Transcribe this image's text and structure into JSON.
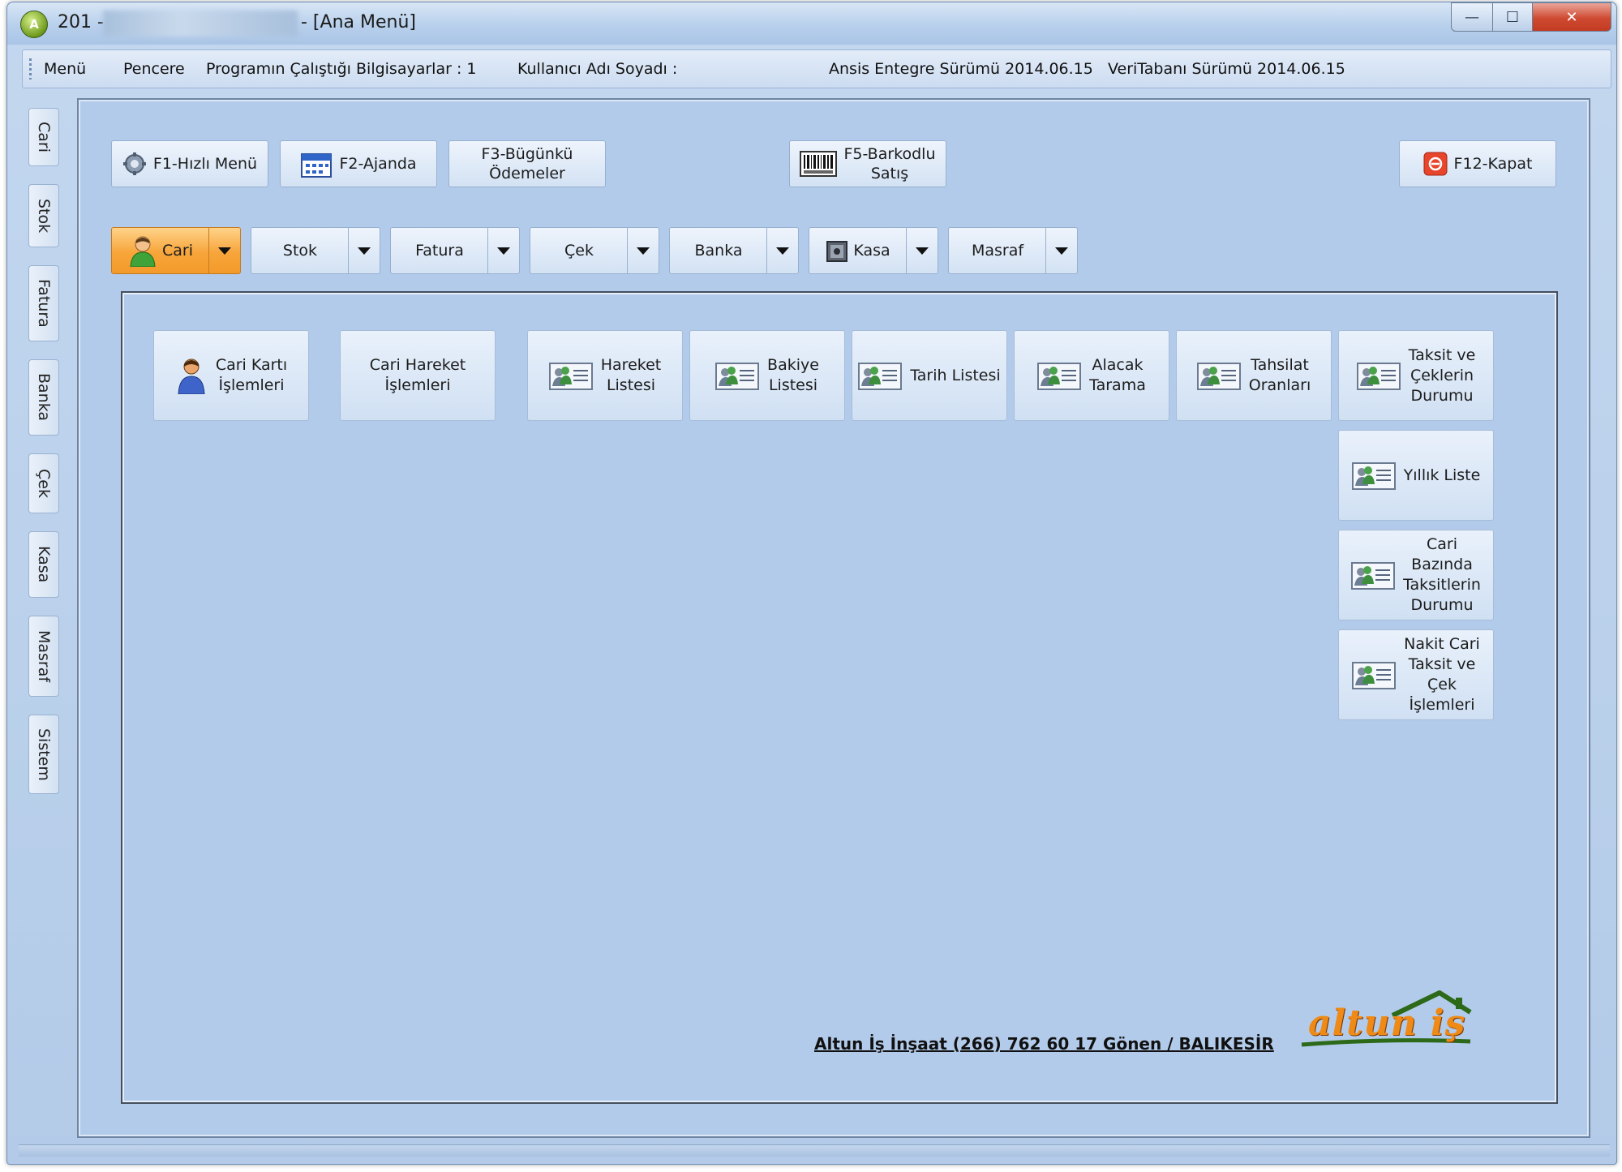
{
  "window": {
    "title_prefix": "201 -",
    "title_suffix": "- [Ana Menü]",
    "app_icon_glyph": "A",
    "caption": {
      "minimize": "—",
      "maximize": "☐",
      "close": "✕"
    }
  },
  "menubar": {
    "menu": "Menü",
    "pencere": "Pencere",
    "computers": "Programın Çalıştığı Bilgisayarlar : 1",
    "user": "Kullanıcı Adı Soyadı :",
    "version": "Ansis Entegre Sürümü 2014.06.15",
    "db_version": "VeriTabanı Sürümü 2014.06.15"
  },
  "sidebar": {
    "tabs": [
      "Cari",
      "Stok",
      "Fatura",
      "Banka",
      "Çek",
      "Kasa",
      "Masraf",
      "Sistem"
    ]
  },
  "toolbar": {
    "f1": "F1-Hızlı Menü",
    "f2": "F2-Ajanda",
    "f3": "F3-Bügünkü\nÖdemeler",
    "f5": "F5-Barkodlu\nSatış",
    "f12": "F12-Kapat"
  },
  "modules": [
    "Cari",
    "Stok",
    "Fatura",
    "Çek",
    "Banka",
    "Kasa",
    "Masraf"
  ],
  "active_module": "Cari",
  "actions": {
    "cari_karti": "Cari Kartı\nİşlemleri",
    "cari_hareket": "Cari Hareket\nİşlemleri",
    "hareket_listesi": "Hareket\nListesi",
    "bakiye_listesi": "Bakiye\nListesi",
    "tarih_listesi": "Tarih Listesi",
    "alacak_tarama": "Alacak\nTarama",
    "tahsilat_oranlari": "Tahsilat\nOranları",
    "taksit_cekler": "Taksit ve\nÇeklerin\nDurumu",
    "yillik_liste": "Yıllık Liste",
    "cari_bazinda": "Cari\nBazında\nTaksitlerin\nDurumu",
    "nakit_cari": "Nakit Cari\nTaksit ve\nÇek\nİşlemleri"
  },
  "footer": {
    "company": "Altun İş İnşaat (266) 762 60 17 Gönen / BALIKESİR",
    "logo": "altun iş"
  },
  "colors": {
    "accent_orange": "#f39a2b",
    "workspace_blue": "#b3cbea",
    "logo_orange": "#ef8a16",
    "logo_green": "#2c6a1a"
  }
}
